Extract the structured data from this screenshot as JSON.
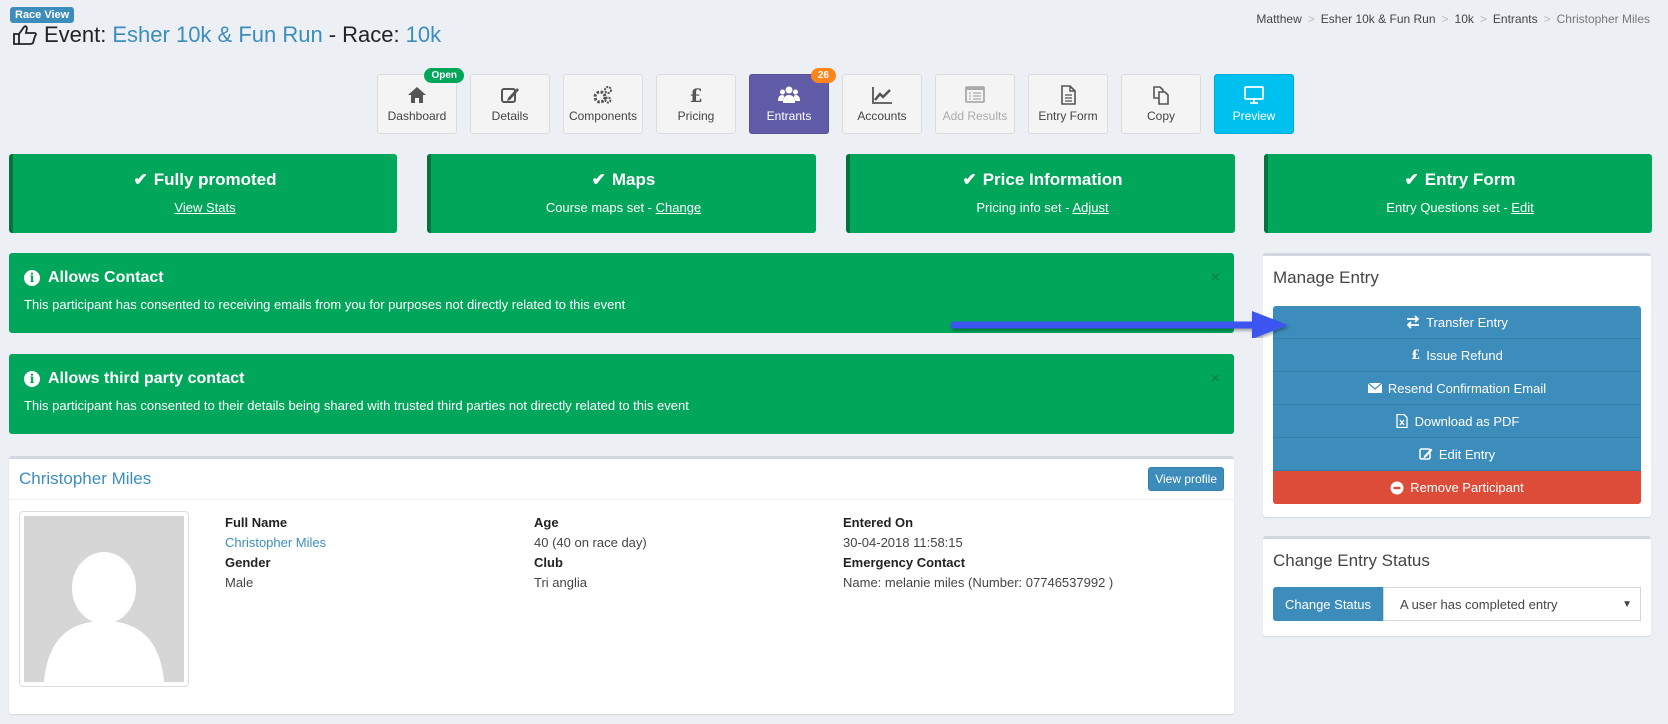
{
  "header": {
    "badge": "Race View",
    "event_label": "Event:",
    "event_name": "Esher 10k & Fun Run",
    "race_sep": "- Race:",
    "race_name": "10k"
  },
  "breadcrumb": [
    "Matthew",
    "Esher 10k & Fun Run",
    "10k",
    "Entrants",
    "Christopher Miles"
  ],
  "toolbar": [
    {
      "label": "Dashboard",
      "icon": "home-icon",
      "badge": "Open"
    },
    {
      "label": "Details",
      "icon": "edit-icon"
    },
    {
      "label": "Components",
      "icon": "gears-icon"
    },
    {
      "label": "Pricing",
      "icon": "pound-icon"
    },
    {
      "label": "Entrants",
      "icon": "users-icon",
      "badge": "26",
      "active": true
    },
    {
      "label": "Accounts",
      "icon": "line-chart-icon"
    },
    {
      "label": "Add Results",
      "icon": "list-icon",
      "disabled": true
    },
    {
      "label": "Entry Form",
      "icon": "document-icon"
    },
    {
      "label": "Copy",
      "icon": "copy-icon"
    },
    {
      "label": "Preview",
      "icon": "monitor-icon"
    }
  ],
  "cards": [
    {
      "title": "Fully promoted",
      "text": "",
      "link": "View Stats"
    },
    {
      "title": "Maps",
      "text": "Course maps set - ",
      "link": "Change"
    },
    {
      "title": "Price Information",
      "text": "Pricing info set - ",
      "link": "Adjust"
    },
    {
      "title": "Entry Form",
      "text": "Entry Questions set - ",
      "link": "Edit"
    }
  ],
  "alerts": [
    {
      "title": "Allows Contact",
      "text": "This participant has consented to receiving emails from you for purposes not directly related to this event",
      "close": "×"
    },
    {
      "title": "Allows third party contact",
      "text": "This participant has consented to their details being shared with trusted third parties not directly related to this event",
      "close": "×"
    }
  ],
  "profile": {
    "name": "Christopher Miles",
    "view_profile": "View profile",
    "fields": {
      "full_name_label": "Full Name",
      "full_name": "Christopher Miles",
      "gender_label": "Gender",
      "gender": "Male",
      "age_label": "Age",
      "age": "40 (40 on race day)",
      "club_label": "Club",
      "club": "Tri anglia",
      "entered_label": "Entered On",
      "entered": "30-04-2018 11:58:15",
      "emergency_label": "Emergency Contact",
      "emergency": "Name: melanie miles (Number: 07746537992 )"
    }
  },
  "manage": {
    "title": "Manage Entry",
    "actions": [
      {
        "label": "Transfer Entry",
        "icon": "exchange-icon"
      },
      {
        "label": "Issue Refund",
        "icon": "pound-icon"
      },
      {
        "label": "Resend Confirmation Email",
        "icon": "envelope-icon"
      },
      {
        "label": "Download as PDF",
        "icon": "file-icon"
      },
      {
        "label": "Edit Entry",
        "icon": "edit-icon"
      },
      {
        "label": "Remove Participant",
        "icon": "minus-circle-icon",
        "danger": true
      }
    ]
  },
  "status": {
    "title": "Change Entry Status",
    "button": "Change Status",
    "selected": "A user has completed entry"
  },
  "colors": {
    "primary": "#3c8dbc",
    "success": "#00a65a",
    "danger": "#dd4b39",
    "active_tab": "#605ca8",
    "preview": "#00c0ef",
    "annotation_arrow": "#3d55f0"
  }
}
